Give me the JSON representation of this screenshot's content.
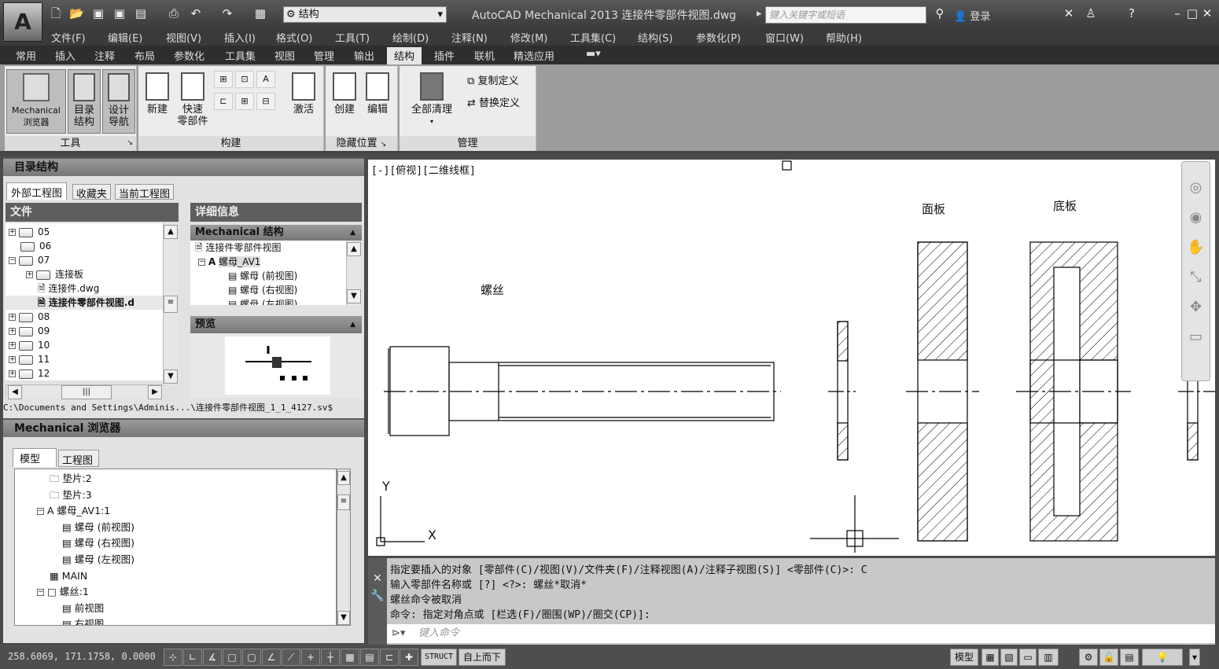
{
  "title": {
    "app_title": "AutoCAD Mechanical 2013    连接件零部件视图.dwg",
    "workspace": "结构",
    "search_placeholder": "键入关键字或短语",
    "login": "登录",
    "app_letter": "A"
  },
  "menu": [
    "文件(F)",
    "编辑(E)",
    "视图(V)",
    "插入(I)",
    "格式(O)",
    "工具(T)",
    "绘制(D)",
    "注释(N)",
    "修改(M)",
    "工具集(C)",
    "结构(S)",
    "参数化(P)",
    "窗口(W)",
    "帮助(H)"
  ],
  "ribbon_tabs": [
    "常用",
    "插入",
    "注释",
    "布局",
    "参数化",
    "工具集",
    "视图",
    "管理",
    "输出",
    "结构",
    "插件",
    "联机",
    "精选应用"
  ],
  "ribbon": {
    "tools": {
      "title": "工具",
      "buttons": [
        "Mechanical\n浏览器",
        "目录\n结构",
        "设计\n导航"
      ]
    },
    "build": {
      "title": "构建",
      "buttons": [
        "新建",
        "快速\n零部件"
      ]
    },
    "activate": "激活",
    "hide": {
      "title": "隐藏位置",
      "buttons": [
        "创建",
        "编辑"
      ]
    },
    "manage": {
      "title": "管理",
      "purge": "全部清理",
      "copy_def": "复制定义",
      "replace_def": "替换定义"
    }
  },
  "catalog": {
    "title": "目录结构",
    "tabs": [
      "外部工程图",
      "收藏夹",
      "当前工程图"
    ],
    "files_header": "文件",
    "details_header": "详细信息",
    "tree": [
      {
        "label": "05",
        "exp": "+"
      },
      {
        "label": "06",
        "exp": ""
      },
      {
        "label": "07",
        "exp": "-"
      },
      {
        "label": "连接板",
        "exp": "+",
        "indent": 1
      },
      {
        "label": "连接件.dwg",
        "indent": 1,
        "file": true
      },
      {
        "label": "连接件零部件视图.d",
        "indent": 1,
        "file": true,
        "bold": true
      },
      {
        "label": "08",
        "exp": "+"
      },
      {
        "label": "09",
        "exp": "+"
      },
      {
        "label": "10",
        "exp": "+"
      },
      {
        "label": "11",
        "exp": "+"
      },
      {
        "label": "12",
        "exp": "+"
      }
    ],
    "mech_struct_header": "Mechanical 结构",
    "details": [
      "连接件零部件视图",
      "螺母_AV1",
      "螺母 (前视图)",
      "螺母 (右视图)",
      "螺母 (左视图)"
    ],
    "preview_header": "预览",
    "path": "C:\\Documents and Settings\\Adminis...\\连接件零部件视图_1_1_4127.sv$"
  },
  "browser": {
    "title": "Mechanical 浏览器",
    "tabs": [
      "模型",
      "工程图"
    ],
    "tree": [
      "垫片:2",
      "垫片:3",
      "螺母_AV1:1",
      "螺母 (前视图)",
      "螺母 (右视图)",
      "螺母 (左视图)",
      "MAIN",
      "螺丝:1",
      "前视图",
      "右视图"
    ]
  },
  "canvas": {
    "viewport_label": "[-][俯视][二维线框]",
    "labels": {
      "screw": "螺丝",
      "face_plate": "面板",
      "base_plate": "底板"
    },
    "ucs_x": "X",
    "ucs_y": "Y"
  },
  "command": {
    "lines": [
      "指定要插入的对象 [零部件(C)/视图(V)/文件夹(F)/注释视图(A)/注释子视图(S)] <零部件(C)>: C",
      "输入零部件名称或 [?] <?>: 螺丝*取消*",
      "螺丝命令被取消",
      "命令: 指定对角点或 [栏选(F)/圈围(WP)/圈交(CP)]:"
    ],
    "placeholder": "键入命令"
  },
  "status": {
    "coords": "258.6069, 171.1758, 0.0000",
    "struct": "STRUCT",
    "topdown": "自上而下",
    "model": "模型"
  }
}
